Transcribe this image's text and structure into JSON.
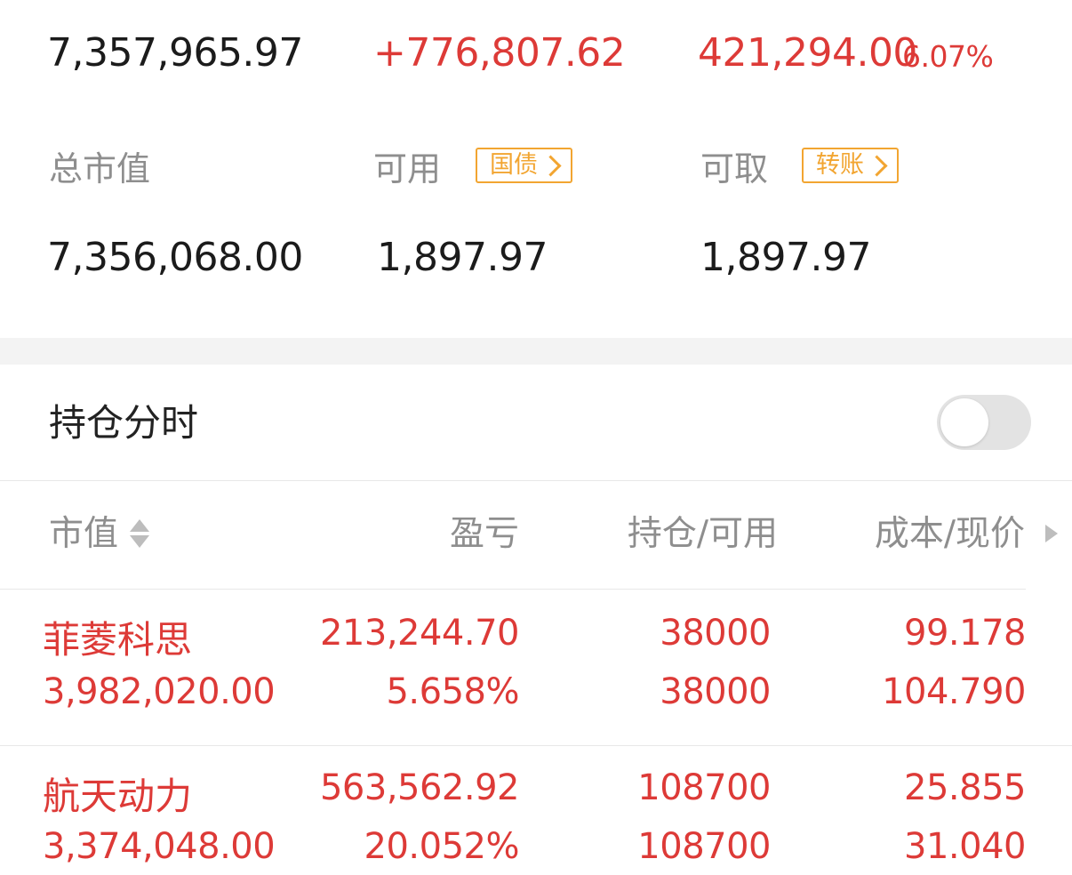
{
  "summary": {
    "total_assets": "7,357,965.97",
    "total_profit": "+776,807.62",
    "daily_profit": "421,294.00",
    "daily_profit_pct": "6.07%"
  },
  "balances": {
    "market_value_label": "总市值",
    "available_label": "可用",
    "treasury_tag": "国债",
    "withdrawable_label": "可取",
    "transfer_tag": "转账",
    "market_value": "7,356,068.00",
    "available": "1,897.97",
    "withdrawable": "1,897.97"
  },
  "intraday": {
    "title": "持仓分时",
    "toggle_on": false
  },
  "table": {
    "headers": {
      "market_value": "市值",
      "profit_loss": "盈亏",
      "position_available": "持仓/可用",
      "cost_price": "成本/现价"
    },
    "rows": [
      {
        "name": "菲菱科思",
        "market_value": "3,982,020.00",
        "profit": "213,244.70",
        "profit_pct": "5.658%",
        "position": "38000",
        "available": "38000",
        "cost": "99.178",
        "price": "104.790"
      },
      {
        "name": "航天动力",
        "market_value": "3,374,048.00",
        "profit": "563,562.92",
        "profit_pct": "20.052%",
        "position": "108700",
        "available": "108700",
        "cost": "25.855",
        "price": "31.040"
      }
    ]
  },
  "colors": {
    "up_red": "#dd3a37",
    "tag_orange": "#f2a531",
    "label_grey": "#8e8e8e"
  }
}
